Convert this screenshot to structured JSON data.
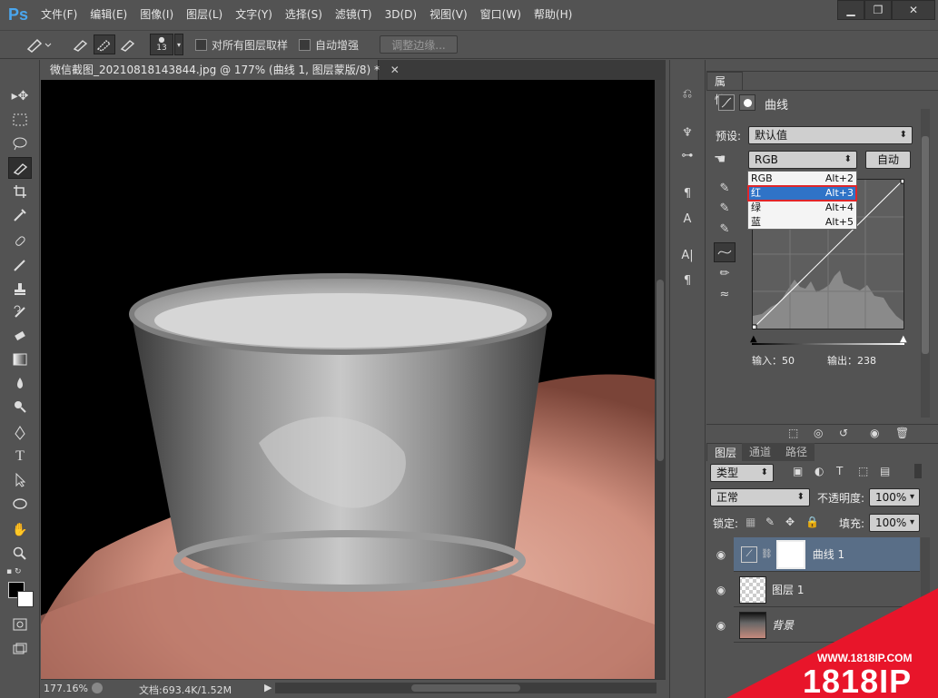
{
  "app": {
    "logo": "Ps"
  },
  "menu": [
    "文件(F)",
    "编辑(E)",
    "图像(I)",
    "图层(L)",
    "文字(Y)",
    "选择(S)",
    "滤镜(T)",
    "3D(D)",
    "视图(V)",
    "窗口(W)",
    "帮助(H)"
  ],
  "window_controls": [
    "▁",
    "❐",
    "✕"
  ],
  "options": {
    "brush_size": "13",
    "sample_all_layers": "对所有图层取样",
    "auto_enhance": "自动增强",
    "refine_edge": "调整边缘..."
  },
  "document": {
    "tab_title": "微信截图_20210818143844.jpg @ 177% (曲线 1, 图层蒙版/8) *",
    "zoom": "177.16%",
    "doc_info": "文档:693.4K/1.52M"
  },
  "properties": {
    "tab": "属性",
    "title": "曲线",
    "preset_label": "预设:",
    "preset_value": "默认值",
    "channel_value": "RGB",
    "auto_button": "自动",
    "input_label": "输入：50",
    "output_label": "输出：238",
    "channel_options": [
      {
        "name": "RGB",
        "shortcut": "Alt+2"
      },
      {
        "name": "红",
        "shortcut": "Alt+3"
      },
      {
        "name": "绿",
        "shortcut": "Alt+4"
      },
      {
        "name": "蓝",
        "shortcut": "Alt+5"
      }
    ],
    "selected_channel_index": 1
  },
  "layers_panel": {
    "tabs": [
      "图层",
      "通道",
      "路径"
    ],
    "filter_label": "类型",
    "blend_mode": "正常",
    "opacity_label": "不透明度:",
    "opacity_value": "100%",
    "lock_label": "锁定:",
    "fill_label": "填充:",
    "fill_value": "100%",
    "layers": [
      {
        "name": "曲线 1",
        "selected": true
      },
      {
        "name": "图层 1",
        "selected": false
      },
      {
        "name": "背景",
        "selected": false
      }
    ]
  },
  "watermark": {
    "url": "WWW.1818IP.COM",
    "brand": "1818IP"
  },
  "colors": {
    "accent_blue": "#2f73c7",
    "highlight_red": "#e0262a",
    "watermark_red": "#e8152a"
  }
}
